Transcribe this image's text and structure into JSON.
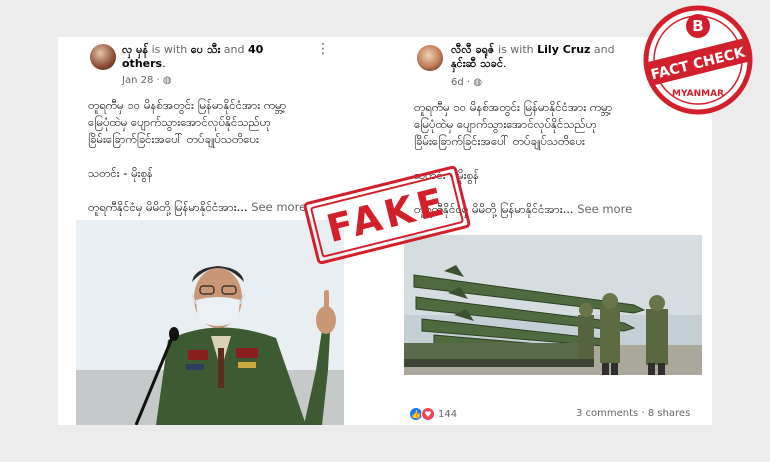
{
  "left_post": {
    "name": "လှ မှန်",
    "with_text": " is with ",
    "tag1": "ပေ သီး",
    "and_text": " and ",
    "tag2": "40",
    "tag2b": "others",
    "date": "Jan 28 · ",
    "body": "တူရကီမှ ၁၀ မိနစ်အတွင်း မြန်မာနိုင်ငံအား ကမ္ဘာ့\nမြေပုံထဲမှ ပျောက်သွားအောင်လုပ်နိုင်သည်ဟု\nခြိမ်းခြောက်ခြင်းအပေါ် တပ်ချုပ်သတိပေး\n\nသတင်း - မိုးစွန်\n\nတူရကီနိုင်ငံမှ မိမိတို့ မြန်မာနိုင်ငံအား...",
    "see_more": " See more"
  },
  "right_post": {
    "name": "လီလီ ခရုဇ်",
    "with_text": " is with ",
    "tag1": "Lily Cruz",
    "and_text": " and",
    "tag2": "နှင်းဆီ သခင်",
    "date": "6d · ",
    "body": "တူရကီမှ ၁၀ မိနစ်အတွင်း မြန်မာနိုင်ငံအား ကမ္ဘာ့\nမြေပုံထဲမှ ပျောက်သွားအောင်လုပ်နိုင်သည်ဟု\nခြိမ်းခြောက်ခြင်းအပေါ် တပ်ချုပ်သတိပေး\n\nသတင်း - မိုးစွန်\n\nတူရကီနိုင်ငံမှ မိမိတို့ မြန်မာနိုင်ငံအား...",
    "see_more": " See more",
    "reaction_count": "144",
    "comments": "3 comments",
    "shares": "8 shares"
  },
  "stamp": {
    "label": "FAKE",
    "color": "#d1202b"
  },
  "badge": {
    "letter": "B",
    "label": "FACT CHECK",
    "sub": "MYANMAR",
    "color": "#d1202b"
  },
  "icons": {
    "more": "more-options-icon",
    "globe": "globe-icon",
    "like": "like-reaction-icon",
    "love": "love-reaction-icon"
  }
}
